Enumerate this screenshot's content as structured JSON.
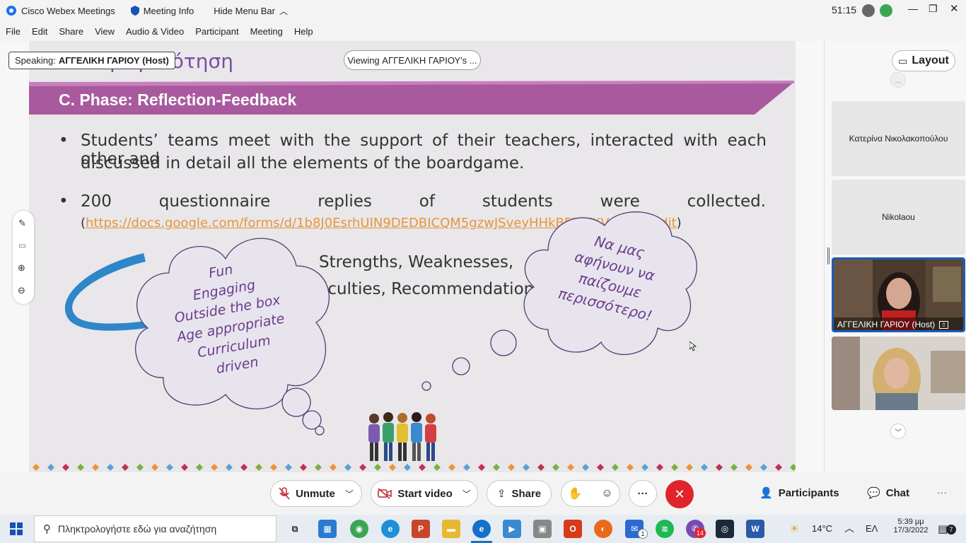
{
  "titlebar": {
    "app_name": "Cisco Webex Meetings",
    "meeting_info": "Meeting Info",
    "hide_menu": "Hide Menu Bar",
    "timer": "51:15"
  },
  "menu": [
    "File",
    "Edit",
    "Share",
    "View",
    "Audio & Video",
    "Participant",
    "Meeting",
    "Help"
  ],
  "stage": {
    "speaking_label": "Speaking:",
    "speaking_name": "ΑΓΓΕΛΙΚΗ ΓΑΡΙΟΥ (Host)",
    "viewing": "Viewing ΑΓΓΕΛΙΚΗ ΓΑΡΙΟΥ's ...",
    "layout": "Layout"
  },
  "slide": {
    "partial_title": "Ανατροφοδότηση",
    "phase_title": "C. Phase: Reflection-Feedback",
    "bullet1_line1": "Students’ teams meet with the support of their teachers, interacted with each other and",
    "bullet1_bold": "discussed",
    "bullet1_line2_rest": " in detail all the elements of the boardgame.",
    "bullet2_line1": "200 questionnaire replies of students were collected.",
    "bullet2_link": "https://docs.google.com/forms/d/1b8J0EsrhUIN9DEDBICQM5gzwJSveyHHkBFbWKVezRbg/edit",
    "strengths": "Strengths,  Weaknesses,",
    "difficulties": "Difficulties, Recommendations",
    "cloud_left": [
      "Fun",
      "Engaging",
      "Outside the box",
      "Age appropriate",
      "Curriculum",
      "driven"
    ],
    "cloud_right": [
      "Να μας",
      "αφήνουν να",
      "παίζουμε",
      "περισσότερο!"
    ]
  },
  "participants_panel": {
    "tiles": [
      {
        "name": "Κατερίνα Νικολακοπούλου"
      },
      {
        "name": "Nikolaou"
      },
      {
        "name": "ΑΓΓΕΛΙΚΗ ΓΑΡΙΟΥ (Host)"
      },
      {
        "name": ""
      }
    ]
  },
  "controls": {
    "unmute": "Unmute",
    "start_video": "Start video",
    "share": "Share",
    "participants": "Participants",
    "chat": "Chat"
  },
  "taskbar": {
    "search_placeholder": "Πληκτρολογήστε εδώ για αναζήτηση",
    "temp": "14°C",
    "lang": "ΕΛ",
    "time": "5:39 μμ",
    "date": "17/3/2022",
    "mail_badge": "1",
    "viber_badge": "14",
    "notif_badge": "7"
  },
  "colors": {
    "banner": "#a95a9e",
    "cloud_text": "#6b3c8b",
    "link": "#e8953a",
    "end_button": "#e0242b",
    "active_border": "#1a5fb4"
  }
}
